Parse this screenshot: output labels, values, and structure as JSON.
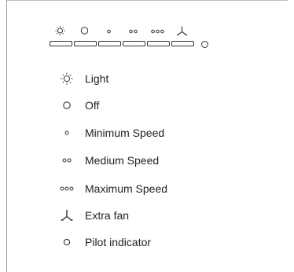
{
  "legend": {
    "items": [
      {
        "icon": "light-icon",
        "label": "Light"
      },
      {
        "icon": "off-icon",
        "label": "Off"
      },
      {
        "icon": "min-speed-icon",
        "label": "Minimum Speed"
      },
      {
        "icon": "med-speed-icon",
        "label": "Medium Speed"
      },
      {
        "icon": "max-speed-icon",
        "label": "Maximum Speed"
      },
      {
        "icon": "extra-fan-icon",
        "label": "Extra fan"
      },
      {
        "icon": "pilot-indicator-icon",
        "label": "Pilot indicator"
      }
    ]
  },
  "panel": {
    "buttons": [
      "light-icon",
      "off-icon",
      "min-speed-icon",
      "med-speed-icon",
      "max-speed-icon",
      "extra-fan-icon"
    ],
    "indicator": "pilot-indicator-icon"
  },
  "colors": {
    "line": "#333333",
    "frame": "#9a9a9a"
  }
}
